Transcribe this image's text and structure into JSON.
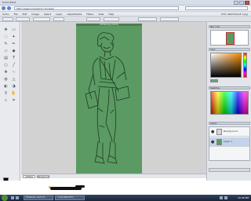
{
  "browser": {
    "window_title": "Sumo Paint",
    "url": "http://www.sumopaint.com/app/"
  },
  "menu": {
    "items": [
      "Sumo",
      "File",
      "Edit",
      "Image",
      "Select",
      "Layer",
      "Adjustments",
      "Filters",
      "View",
      "Help"
    ],
    "user": "Edit: GRAYSCALE 1.jpg"
  },
  "canvas": {
    "tab_title": "Untitled.jpg (100%)",
    "background_color": "#5b9a63"
  },
  "doc_tabs": [
    "Untitled",
    "Background"
  ],
  "panels": {
    "navigator_title": "Nav | Info",
    "colors_title": "Color",
    "swatches_title": "Swatches",
    "layers_title": "Layers",
    "picked_color": "#6fa079"
  },
  "layers": [
    {
      "name": "Background",
      "color": "#d8d8d8"
    },
    {
      "name": "Layer 1",
      "color": "#5b9a63"
    }
  ],
  "taskbar": {
    "items": [
      "Facebook | Sumo P...",
      "2 SumoPaint Ed..."
    ],
    "clock": "10:46 PM"
  },
  "icons": [
    "search-icon",
    "close-icon",
    "eye-icon",
    "brush-icon",
    "pencil-icon",
    "eraser-icon",
    "bucket-icon",
    "text-icon",
    "zoom-icon",
    "move-icon",
    "lasso-icon",
    "shape-icon",
    "eyedropper-icon"
  ]
}
